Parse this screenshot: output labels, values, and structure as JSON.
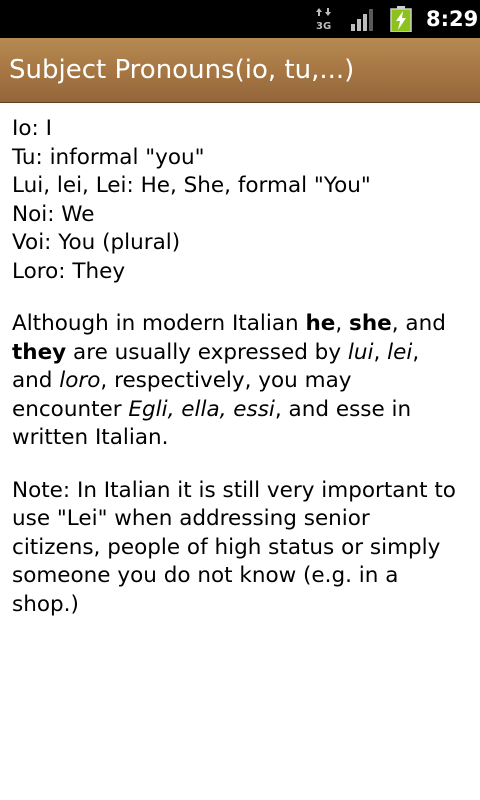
{
  "status_bar": {
    "network_type": "3G",
    "time": "8:29",
    "icons": [
      "data-transfer-3g-icon",
      "signal-strength-icon",
      "battery-charging-icon"
    ]
  },
  "title_bar": {
    "title": "Subject Pronouns(io, tu,...)"
  },
  "content": {
    "pronouns": [
      "Io: I",
      "Tu: informal \"you\"",
      "Lui, lei, Lei: He, She, formal \"You\"",
      "Noi: We",
      "Voi: You (plural)",
      "Loro: They"
    ],
    "paragraph2": {
      "t1": "Although in modern Italian ",
      "b1": "he",
      "t2": ", ",
      "b2": "she",
      "t3": ", and ",
      "b3": "they",
      "t4": " are usually expressed by ",
      "i1": "lui",
      "t5": ", ",
      "i2": "lei",
      "t6": ", and ",
      "i3": "loro",
      "t7": ", respectively, you may encounter ",
      "i4": "Egli, ella, essi",
      "t8": ", and esse in written Italian."
    },
    "note": "Note: In Italian it is still very important to use \"Lei\" when addressing senior citizens, people of high status or simply someone you do not know (e.g. in a shop.)"
  },
  "colors": {
    "title_bar": "#a57542",
    "status_bar": "#000000",
    "background": "#ffffff",
    "text": "#000000",
    "battery_charge": "#8bc21c"
  }
}
